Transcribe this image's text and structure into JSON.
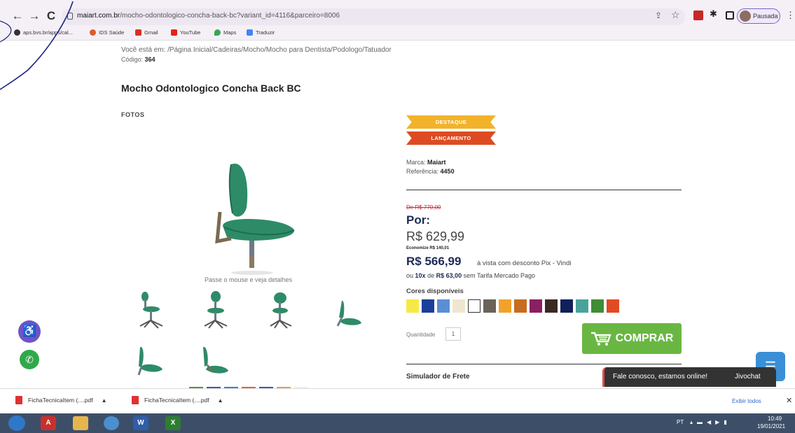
{
  "browser": {
    "url_prefix": "",
    "url_domain": "maiart.com.br",
    "url_path": "/mocho-odontologico-concha-back-bc?variant_id=4116&parceiro=8006",
    "profile_label": "Pausada",
    "bookmarks": [
      {
        "label": "aps.bvs.br/apps/cal..."
      },
      {
        "label": "IDS Saúde"
      },
      {
        "label": "Gmail"
      },
      {
        "label": "YouTube"
      },
      {
        "label": "Maps"
      },
      {
        "label": "Traduzir"
      }
    ]
  },
  "page": {
    "breadcrumb": "Você está em: /Página Inicial/Cadeiras/Mocho/Mocho para Dentista/Podologo/Tatuador",
    "code_label": "Código:",
    "code_value": "364",
    "title": "Mocho Odontologico Concha Back BC",
    "photos_label": "FOTOS",
    "hover_hint": "Passe o mouse e veja detalhes"
  },
  "badges": {
    "destaque": "DESTAQUE",
    "lancamento": "LANÇAMENTO"
  },
  "product": {
    "brand_label": "Marca:",
    "brand_value": "Maiart",
    "reference_label": "Referência:",
    "reference_value": "4450",
    "old_price": "De R$ 770,00",
    "por_label": "Por:",
    "price": "R$ 629,99",
    "savings": "Economize R$ 140,01",
    "pix_price": "R$ 566,99",
    "pix_desc": "à vista com desconto Pix - Vindi",
    "installments_prefix": "ou",
    "installments_count": "10x",
    "installments_de": "de",
    "installments_value": "R$ 63,00",
    "installments_suffix": "sem Tarifa Mercado Pago",
    "colors_label": "Cores disponíveis",
    "colors": [
      "#f5ea45",
      "#1b3f9a",
      "#5a8fd6",
      "#efe6cf",
      "#ffffff",
      "#6b6357",
      "#f2a22a",
      "#c86c1e",
      "#8a1f63",
      "#3b2a22",
      "#10205a",
      "#4aa39a",
      "#3f8d34",
      "#e24a24"
    ],
    "quantity_label": "Quantidade",
    "quantity_value": "1",
    "buy_label": "COMPRAR",
    "freight_title": "Simulador de Frete"
  },
  "chat": {
    "text": "Fale conosco, estamos online!",
    "brand": "Jivochat"
  },
  "downloads": {
    "items": [
      {
        "name": "FichaTecnicaItem (....pdf"
      },
      {
        "name": "FichaTecnicaItem (....pdf"
      }
    ],
    "show_all": "Exibir todos"
  },
  "taskbar": {
    "lang": "PT",
    "time": "10:49",
    "date": "19/01/2021"
  },
  "colors": {
    "accent_navy": "#1c2b57",
    "buy_green": "#69b742",
    "badge_orange": "#f2b32b",
    "badge_red": "#de4b22"
  }
}
